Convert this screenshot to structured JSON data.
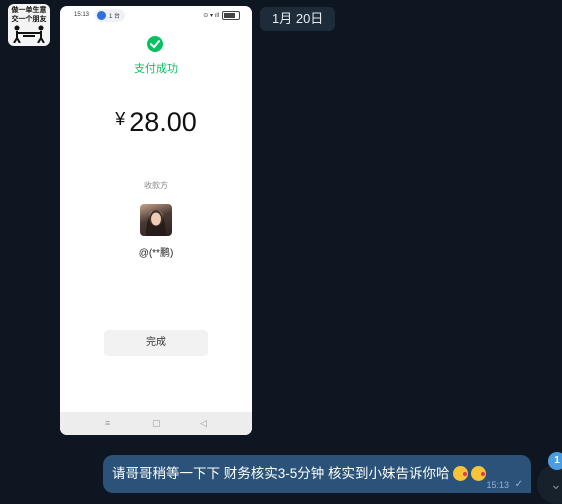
{
  "sender": {
    "avatar_lines": [
      "做一单生意",
      "交一个朋友"
    ]
  },
  "date_pill": "1月 20日",
  "screenshot": {
    "status_time": "15:13",
    "account_chip": "1 台",
    "signal_text": "⊙ ▾ ıll",
    "success_text": "支付成功",
    "currency_symbol": "¥",
    "amount": "28.00",
    "payee_label": "收款方",
    "payee_name": "@(**鹏)",
    "done_button": "完成",
    "nav_buttons": [
      "≡",
      "▢",
      "◁"
    ]
  },
  "message": {
    "text": "请哥哥稍等一下下 财务核实3-5分钟 核实到小妹告诉你哈",
    "emojis": [
      "kissing-face-emoji",
      "kissing-face-emoji"
    ],
    "time": "15:13",
    "status_icon": "✓"
  },
  "unread_count": "1",
  "colors": {
    "chat_background": "#0e1621",
    "outgoing_bubble": "#2b5278",
    "wechat_green": "#07c160"
  }
}
